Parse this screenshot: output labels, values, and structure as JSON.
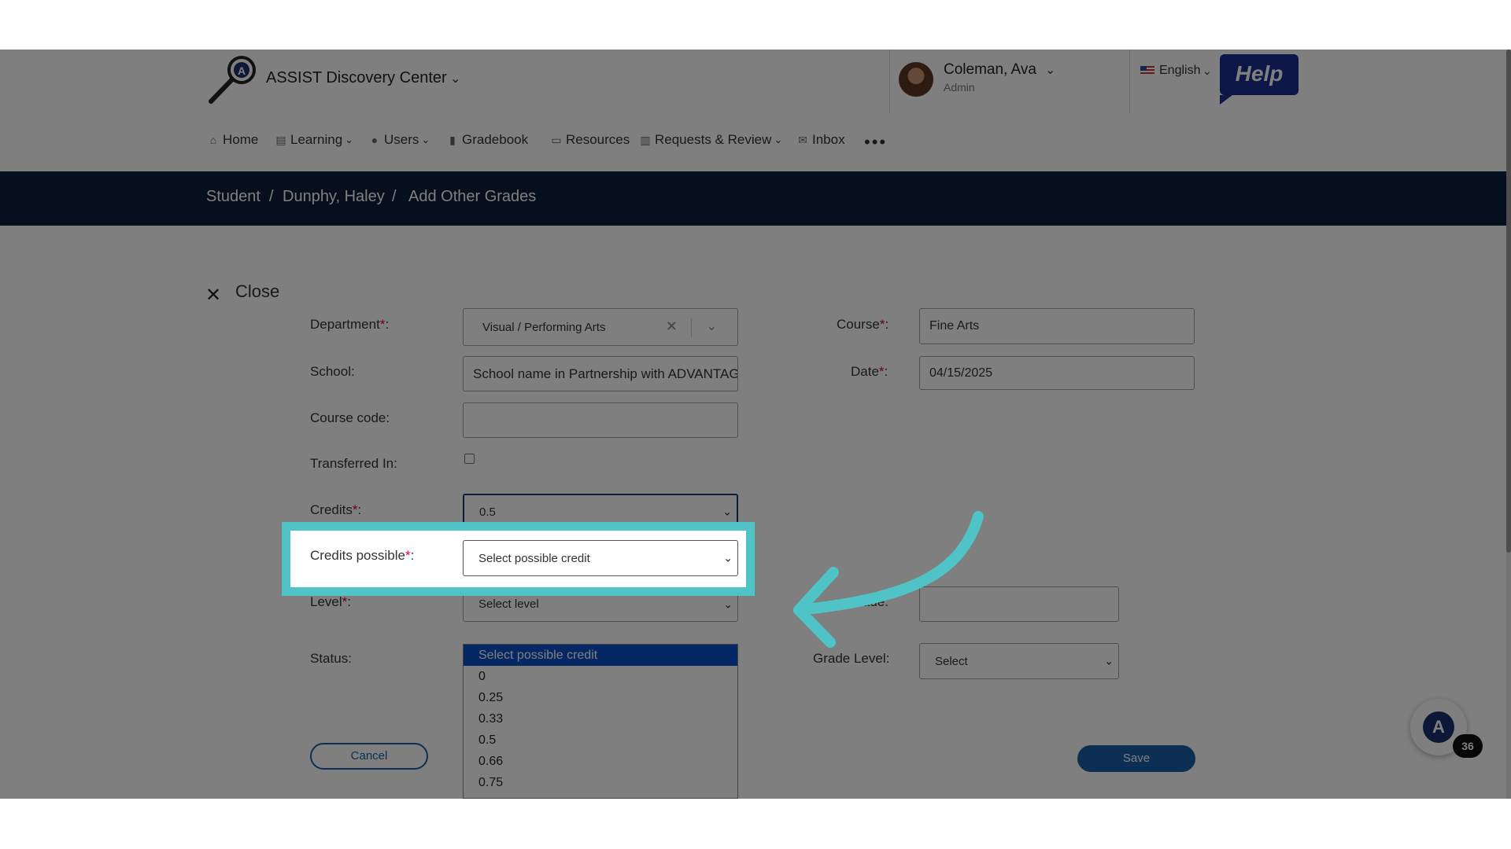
{
  "header": {
    "app_name": "ASSIST Discovery Center",
    "user": {
      "name": "Coleman, Ava",
      "role": "Admin"
    },
    "language": "English",
    "help_label": "Help"
  },
  "nav": [
    {
      "label": "Home",
      "icon": "home-icon"
    },
    {
      "label": "Learning",
      "icon": "learning-icon",
      "has_menu": true
    },
    {
      "label": "Users",
      "icon": "users-icon",
      "has_menu": true
    },
    {
      "label": "Gradebook",
      "icon": "gradebook-icon"
    },
    {
      "label": "Resources",
      "icon": "resources-icon"
    },
    {
      "label": "Requests & Review",
      "icon": "requests-icon",
      "has_menu": true
    },
    {
      "label": "Inbox",
      "icon": "inbox-icon"
    }
  ],
  "breadcrumb": [
    "Student",
    "Dunphy, Haley",
    "Add Other Grades"
  ],
  "breadcrumb_sep": "/",
  "close_label": "Close",
  "form": {
    "department": {
      "label": "Department",
      "value": "Visual / Performing Arts"
    },
    "course": {
      "label": "Course",
      "value": "Fine Arts"
    },
    "school": {
      "label": "School",
      "value": "School name in Partnership with ADVANTAGE"
    },
    "date": {
      "label": "Date",
      "value": "04/15/2025"
    },
    "course_code": {
      "label": "Course code",
      "value": ""
    },
    "transferred_in": {
      "label": "Transferred In",
      "checked": false
    },
    "credits": {
      "label": "Credits",
      "value": "0.5"
    },
    "credits_possible": {
      "label": "Credits possible",
      "value": "Select possible credit"
    },
    "level": {
      "label": "Level",
      "value": "Select level"
    },
    "grade": {
      "label": "Grade",
      "value": ""
    },
    "status": {
      "label": "Status"
    },
    "grade_level": {
      "label": "Grade Level",
      "value": "Select"
    },
    "required_mark": "*",
    "label_suffix": ":"
  },
  "credits_possible_options": [
    "Select possible credit",
    "0",
    "0.25",
    "0.33",
    "0.5",
    "0.66",
    "0.75"
  ],
  "buttons": {
    "cancel": "Cancel",
    "save": "Save"
  },
  "chat_badge_count": "36",
  "colors": {
    "highlight": "#4fc3c6",
    "primary": "#1b5fa8",
    "breadcrumb_bg": "#0b1f3a",
    "required": "#d9002e"
  }
}
